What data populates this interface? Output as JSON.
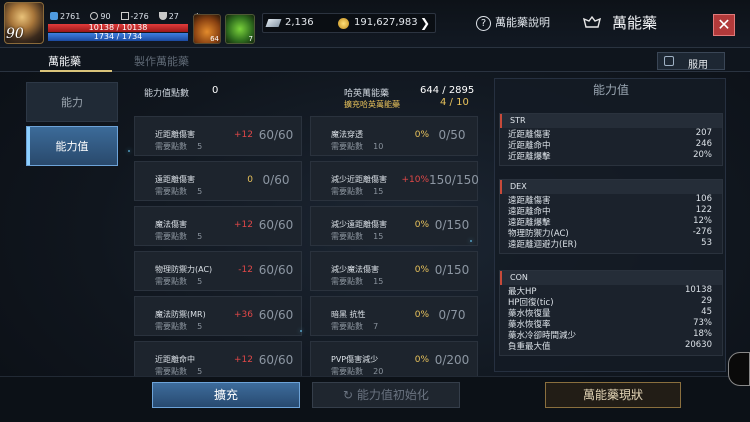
{
  "player": {
    "level": "90",
    "stats": [
      "2761",
      "90",
      "-276",
      "27"
    ],
    "hp": "10138 / 10138",
    "mp": "1734 / 1734"
  },
  "items": {
    "potion_count": "64",
    "leaf_count": "7"
  },
  "currency": {
    "crystal": "2,136",
    "gold": "191,627,983"
  },
  "header": {
    "help_label": "萬能藥說明",
    "title": "萬能藥",
    "close": "✕"
  },
  "tabs": [
    {
      "label": "萬能藥",
      "active": true
    },
    {
      "label": "製作萬能藥",
      "active": false
    }
  ],
  "use_button": "服用",
  "nav": [
    {
      "label": "能力",
      "active": false
    },
    {
      "label": "能力值",
      "active": true
    }
  ],
  "points": {
    "label": "能力值點數",
    "value": "0",
    "hy_label": "哈英萬能藥",
    "hy_value": "644 / 2895",
    "expand_label": "擴充哈英萬能藥",
    "expand_value": "4 / 10"
  },
  "required_label": "需要點數",
  "cards": [
    {
      "name": "近距離傷害",
      "req": "5",
      "bonus": "+12",
      "bonus_color": "red",
      "current": "60/60"
    },
    {
      "name": "魔法穿透",
      "req": "10",
      "bonus": "0%",
      "bonus_color": "yellow",
      "current": "0/50"
    },
    {
      "name": "遠距離傷害",
      "req": "5",
      "bonus": "0",
      "bonus_color": "yellow",
      "current": "0/60"
    },
    {
      "name": "減少近距離傷害",
      "req": "15",
      "bonus": "+10%",
      "bonus_color": "red",
      "current": "150/150"
    },
    {
      "name": "魔法傷害",
      "req": "5",
      "bonus": "+12",
      "bonus_color": "red",
      "current": "60/60"
    },
    {
      "name": "減少遠距離傷害",
      "req": "15",
      "bonus": "0%",
      "bonus_color": "yellow",
      "current": "0/150"
    },
    {
      "name": "物理防禦力(AC)",
      "req": "5",
      "bonus": "-12",
      "bonus_color": "red",
      "current": "60/60"
    },
    {
      "name": "減少魔法傷害",
      "req": "15",
      "bonus": "0%",
      "bonus_color": "yellow",
      "current": "0/150"
    },
    {
      "name": "魔法防禦(MR)",
      "req": "5",
      "bonus": "+36",
      "bonus_color": "red",
      "current": "60/60"
    },
    {
      "name": "暗黑 抗性",
      "req": "7",
      "bonus": "0%",
      "bonus_color": "yellow",
      "current": "0/70"
    },
    {
      "name": "近距離命中",
      "req": "5",
      "bonus": "+12",
      "bonus_color": "red",
      "current": "60/60"
    },
    {
      "name": "PVP傷害減少",
      "req": "20",
      "bonus": "0%",
      "bonus_color": "yellow",
      "current": "0/200"
    }
  ],
  "panel": {
    "title": "能力值",
    "groups": [
      {
        "name": "STR",
        "rows": [
          [
            "近距離傷害",
            "207"
          ],
          [
            "近距離命中",
            "246"
          ],
          [
            "近距離爆擊",
            "20%"
          ]
        ]
      },
      {
        "name": "DEX",
        "rows": [
          [
            "遠距離傷害",
            "106"
          ],
          [
            "遠距離命中",
            "122"
          ],
          [
            "遠距離爆擊",
            "12%"
          ],
          [
            "物理防禦力(AC)",
            "-276"
          ],
          [
            "遠距離迴避力(ER)",
            "53"
          ]
        ]
      },
      {
        "name": "CON",
        "rows": [
          [
            "最大HP",
            "10138"
          ],
          [
            "HP回復(tic)",
            "29"
          ],
          [
            "藥水恢復量",
            "45"
          ],
          [
            "藥水恢復率",
            "73%"
          ],
          [
            "藥水冷卻時間減少",
            "18%"
          ],
          [
            "負重最大值",
            "20630"
          ]
        ]
      }
    ]
  },
  "buttons": {
    "expand": "擴充",
    "reset": "能力值初始化",
    "status": "萬能藥現狀"
  },
  "colors": {
    "accent_blue": "#3d6c9c",
    "bonus_red": "#e04848",
    "bonus_yellow": "#e8c25b",
    "close_red": "#b23a3a"
  }
}
